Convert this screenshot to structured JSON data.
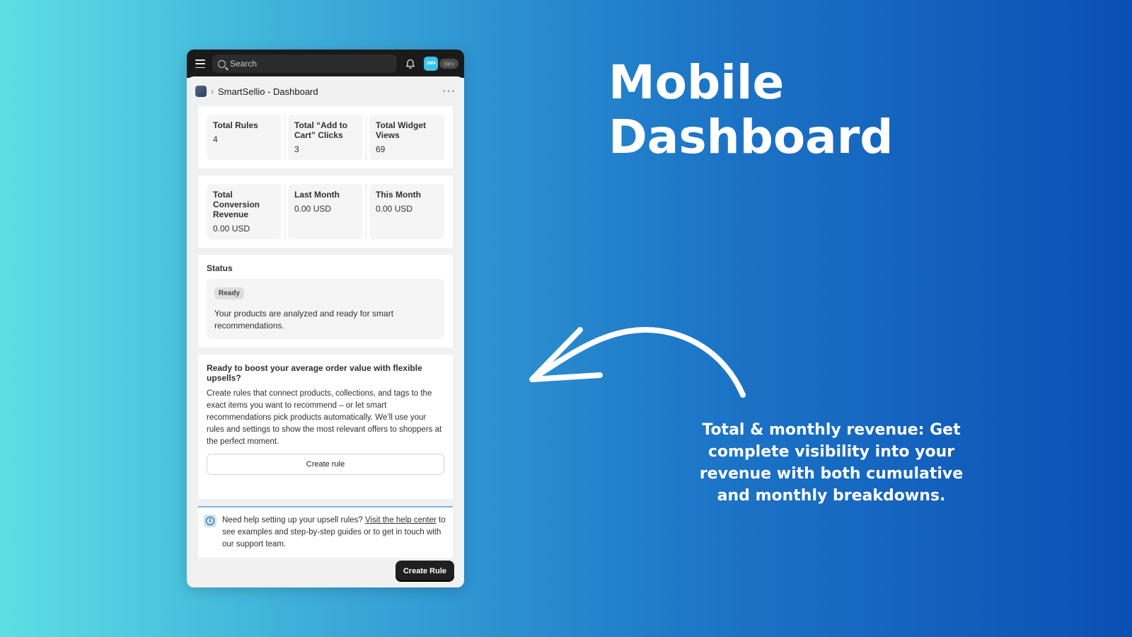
{
  "headline": "Mobile Dashboard",
  "caption": "Total & monthly revenue: Get complete visibility into your revenue with both cumulative and monthly breakdowns.",
  "topbar": {
    "search_placeholder": "Search",
    "avatar_initials": "SMA",
    "env_badge": "dev"
  },
  "page": {
    "title": "SmartSellio - Dashboard",
    "more": "···"
  },
  "stats_row1": [
    {
      "label": "Total Rules",
      "value": "4"
    },
    {
      "label": "Total “Add to Cart” Clicks",
      "value": "3"
    },
    {
      "label": "Total Widget Views",
      "value": "69"
    }
  ],
  "stats_row2": [
    {
      "label": "Total Conversion Revenue",
      "value": "0.00 USD"
    },
    {
      "label": "Last Month",
      "value": "0.00 USD"
    },
    {
      "label": "This Month",
      "value": "0.00 USD"
    }
  ],
  "status": {
    "title": "Status",
    "badge": "Ready",
    "text": "Your products are analyzed and ready for smart recommendations."
  },
  "upsell": {
    "title": "Ready to boost your average order value with flexible upsells?",
    "text": "Create rules that connect products, collections, and tags to the exact items you want to recommend – or let smart recommendations pick products automatically. We’ll use your rules and settings to show the most relevant offers to shoppers at the perfect moment.",
    "button": "Create rule"
  },
  "help": {
    "text_before": "Need help setting up your upsell rules? ",
    "link": "Visit the help center",
    "text_after": " to see examples and step-by-step guides or to get in touch with our support team."
  },
  "primary_button": "Create Rule",
  "colors": {
    "topbar": "#1a1a1a",
    "primary_button": "#1f1f1f",
    "avatar": "#3cc3e8"
  }
}
